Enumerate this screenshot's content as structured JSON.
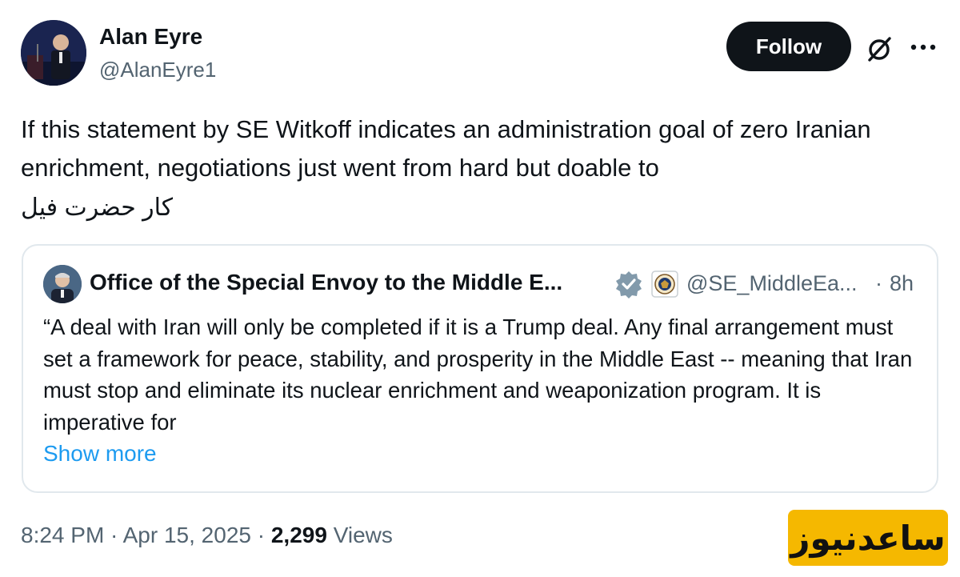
{
  "author": {
    "name": "Alan Eyre",
    "handle": "@AlanEyre1"
  },
  "header": {
    "follow_label": "Follow",
    "grok_icon": "grok-icon",
    "more_icon": "more-icon"
  },
  "tweet": {
    "text": "If this statement by SE Witkoff indicates an administration goal of zero Iranian enrichment, negotiations just went from hard but doable to",
    "text_persian": "کار حضرت فیل"
  },
  "quote": {
    "name": "Office of the Special Envoy to the Middle E...",
    "handle": "@SE_MiddleEa...",
    "separator": "·",
    "time": "8h",
    "text": "“A deal with Iran will only be completed if it is a Trump deal. Any final arrangement must set a framework for peace, stability, and prosperity in the Middle East -- meaning that Iran must stop and eliminate its nuclear enrichment and weaponization program. It is imperative for",
    "show_more": "Show more",
    "verified_color": "#829aab"
  },
  "meta": {
    "time": "8:24 PM",
    "sep1": " · ",
    "date": "Apr 15, 2025",
    "sep2": " · ",
    "views_count": "2,299",
    "views_label": " Views"
  },
  "watermark": {
    "text": "ساعدنیوز",
    "color": "#f5b800"
  },
  "colors": {
    "text_primary": "#0f1419",
    "text_secondary": "#536471",
    "link": "#1d9bf0",
    "border": "#e1e8ed"
  }
}
